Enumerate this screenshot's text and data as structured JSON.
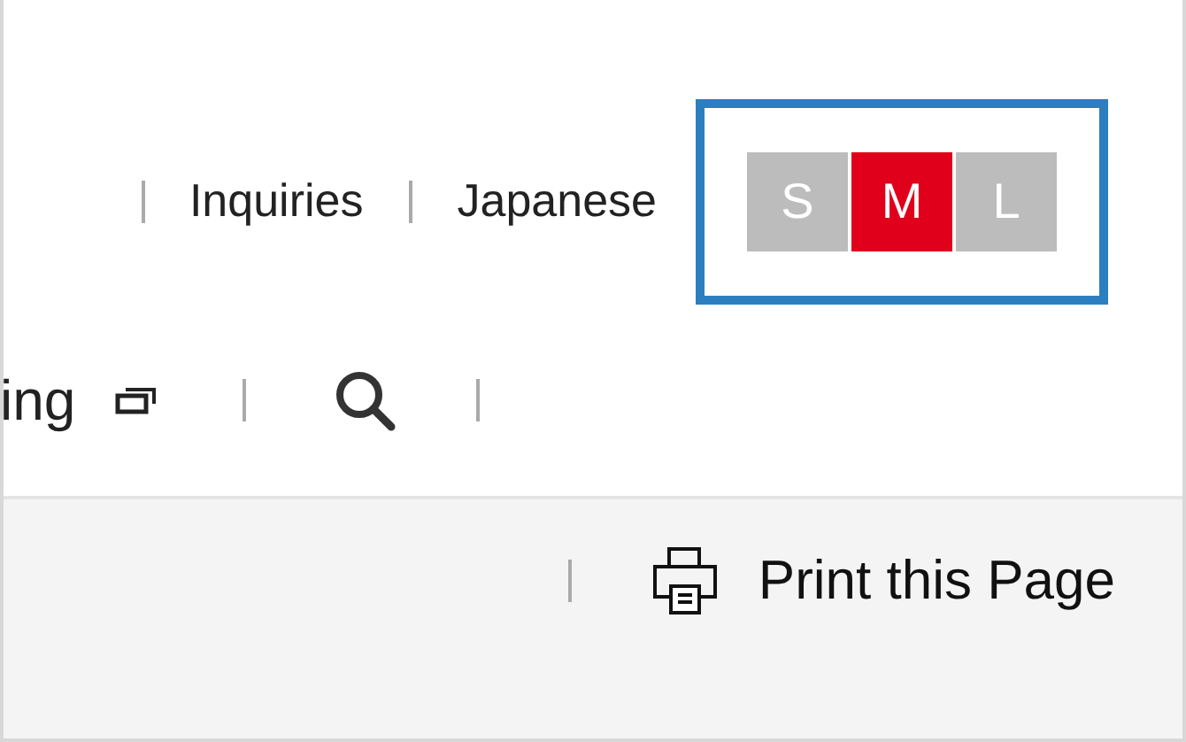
{
  "header_links": [
    {
      "label": "Inquiries"
    },
    {
      "label": "Japanese"
    }
  ],
  "font_size": {
    "options": [
      {
        "label": "S",
        "selected": false
      },
      {
        "label": "M",
        "selected": true
      },
      {
        "label": "L",
        "selected": false
      }
    ]
  },
  "nav": {
    "partial_item": "ing"
  },
  "print": {
    "label": "Print this Page"
  }
}
